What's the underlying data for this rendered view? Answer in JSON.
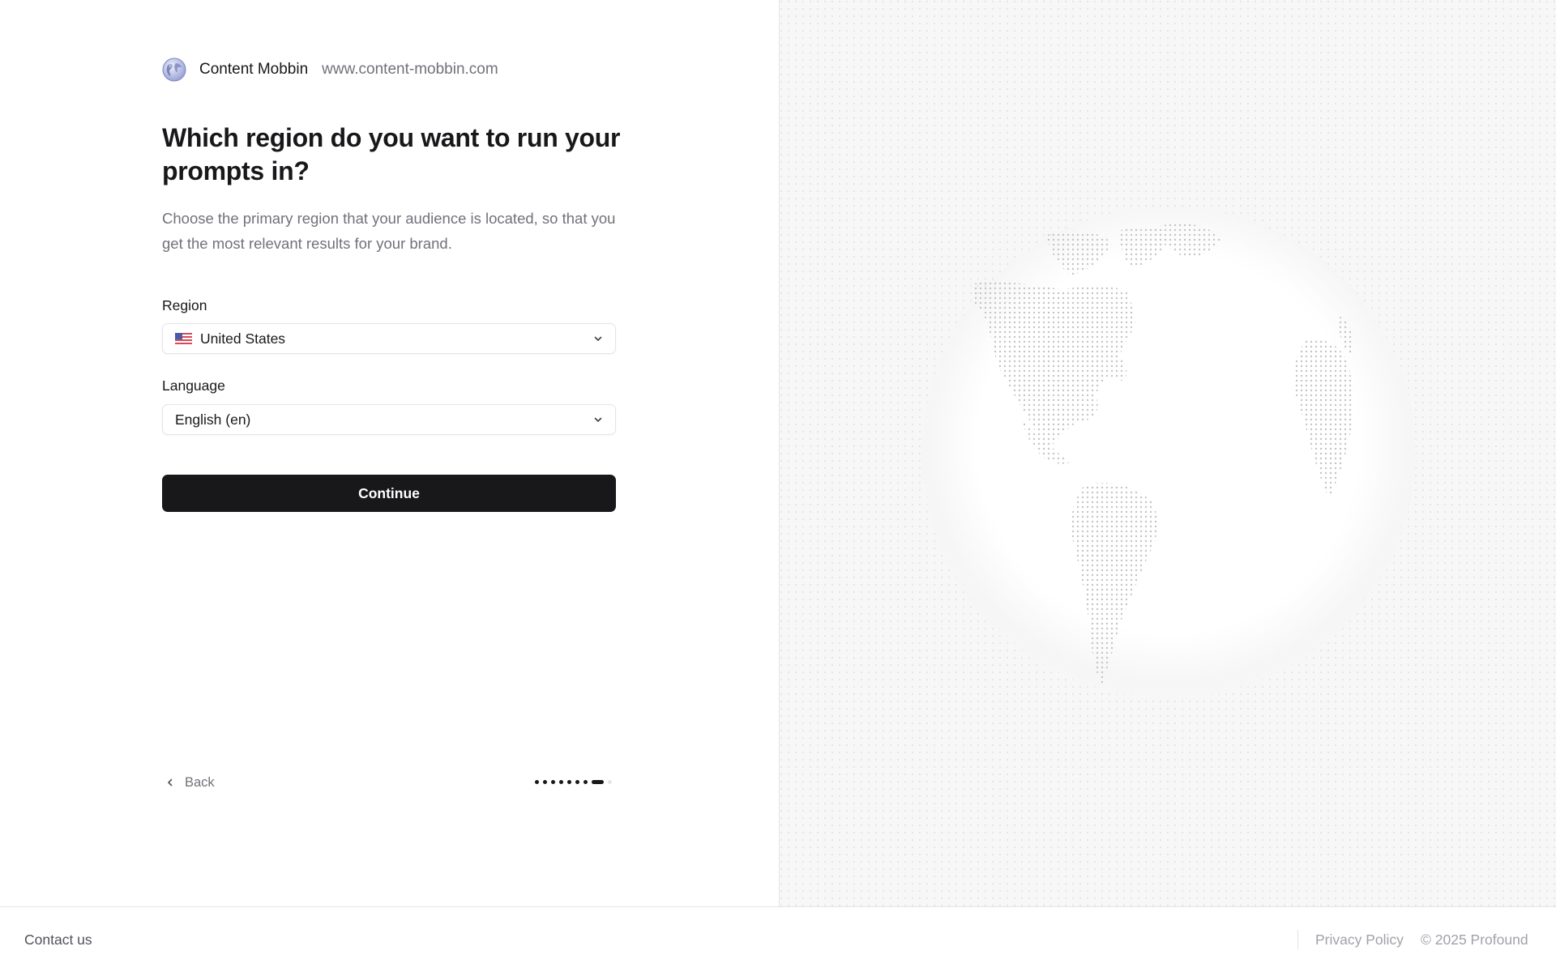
{
  "brand": {
    "name": "Content Mobbin",
    "domain": "www.content-mobbin.com"
  },
  "main": {
    "heading": "Which region do you want to run your prompts in?",
    "subtext": "Choose the primary region that your audience is located, so that you get the most relevant results for your brand.",
    "region": {
      "label": "Region",
      "value": "United States",
      "flag_icon": "us-flag-icon"
    },
    "language": {
      "label": "Language",
      "value": "English (en)"
    },
    "continue_label": "Continue"
  },
  "nav": {
    "back_label": "Back",
    "progress": {
      "total_steps": 9,
      "current_step": 8
    }
  },
  "footer": {
    "contact": "Contact us",
    "privacy": "Privacy Policy",
    "copyright": "© 2025 Profound"
  },
  "colors": {
    "primary": "#18181b",
    "muted_text": "#71717a",
    "border": "#e4e4e7",
    "panel_bg": "#f7f7f7"
  }
}
